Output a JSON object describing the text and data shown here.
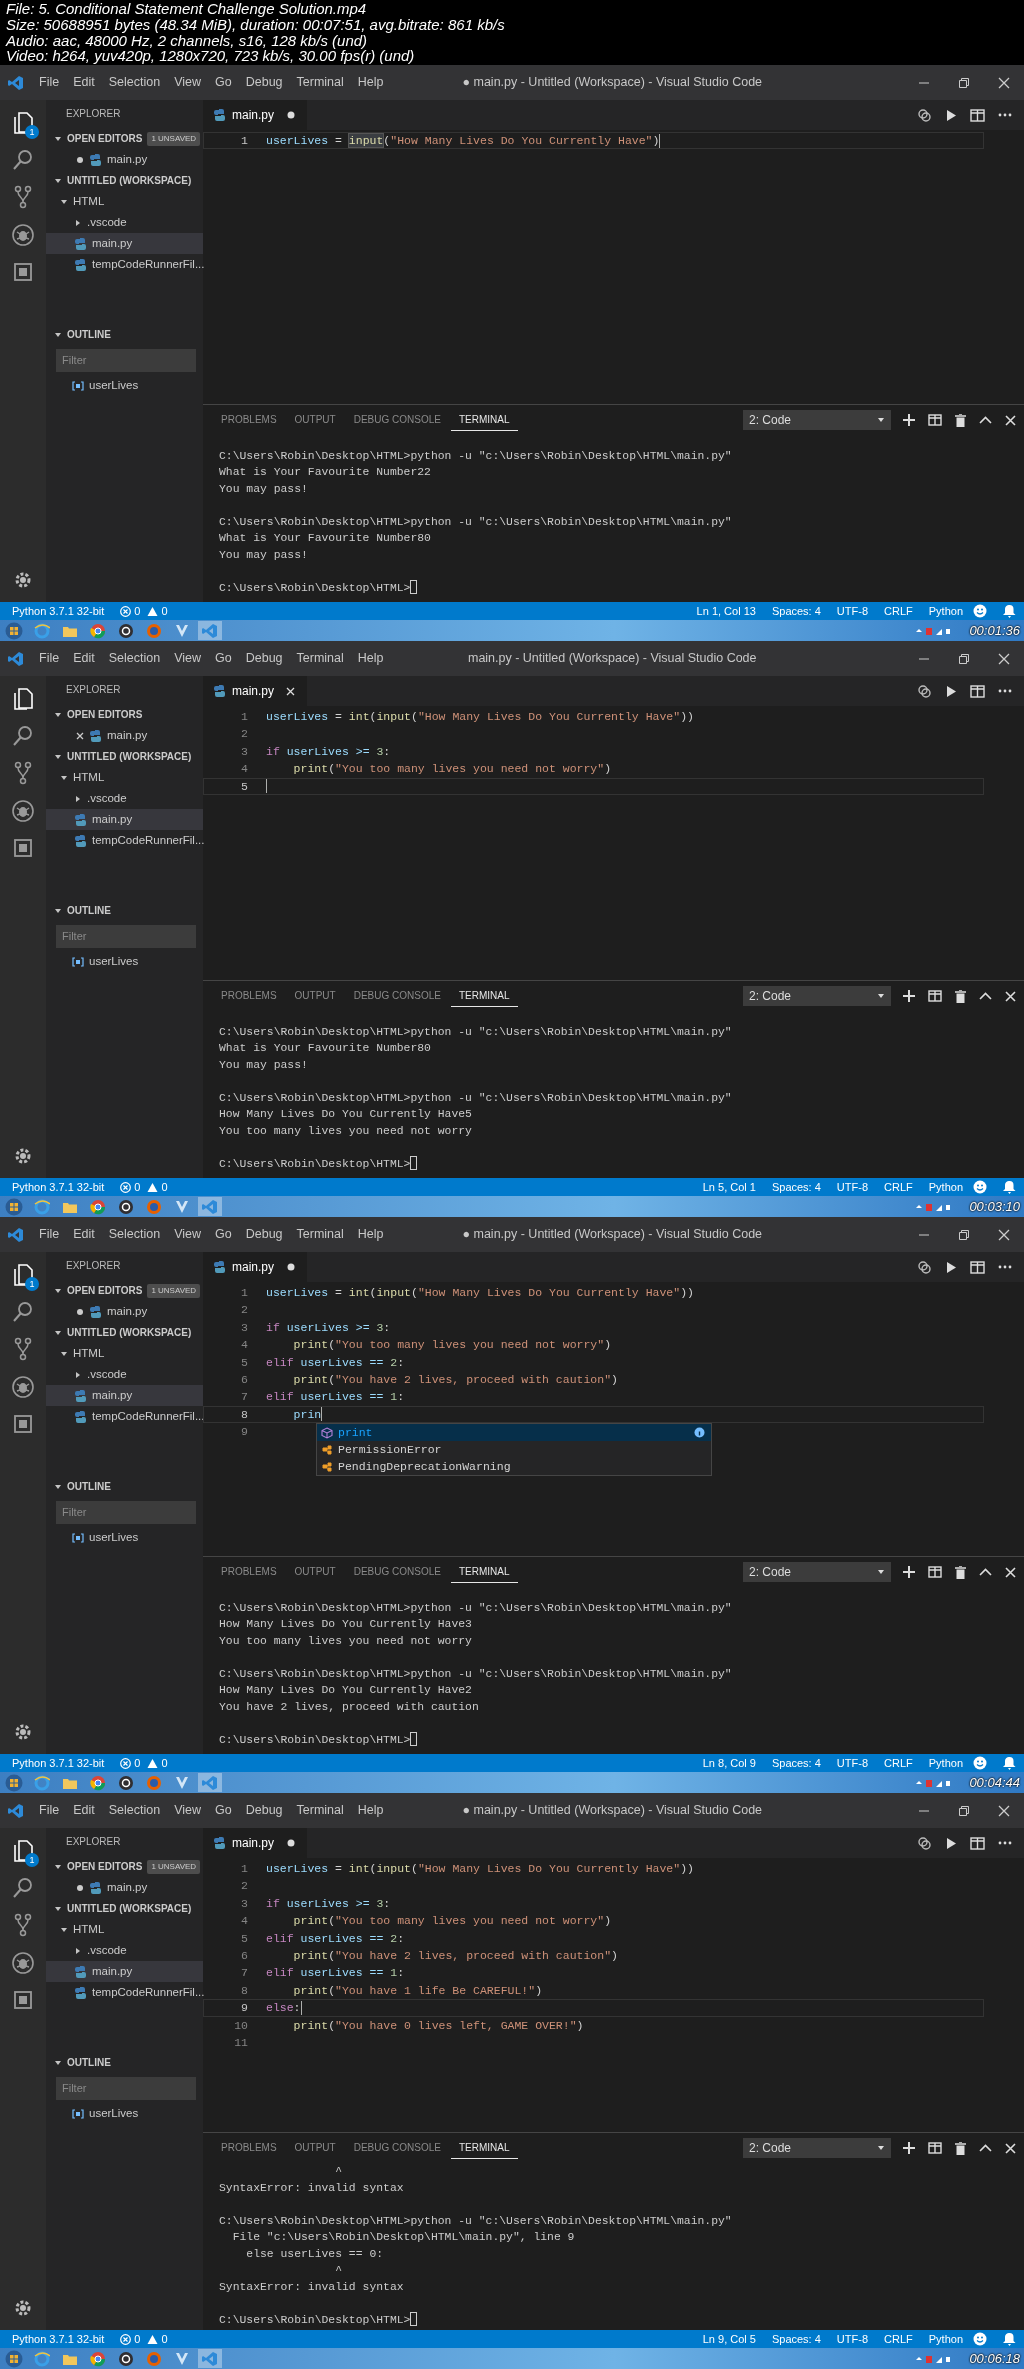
{
  "file_info": [
    "File: 5. Conditional Statement Challenge Solution.mp4",
    "Size: 50688951 bytes (48.34 MiB), duration: 00:07:51, avg.bitrate: 861 kb/s",
    "Audio: aac, 48000 Hz, 2 channels, s16, 128 kb/s (und)",
    "Video: h264, yuv420p, 1280x720, 723 kb/s, 30.00 fps(r) (und)"
  ],
  "frames": [
    {
      "window": {
        "title": "● main.py - Untitled (Workspace) - Visual Studio Code"
      },
      "menu": [
        "File",
        "Edit",
        "Selection",
        "View",
        "Go",
        "Debug",
        "Terminal",
        "Help"
      ],
      "activity_badge": "1",
      "sidebar": {
        "title": "EXPLORER",
        "open_editors": {
          "label": "OPEN EDITORS",
          "expanded": true,
          "badge": "1 UNSAVED",
          "items": [
            {
              "label": "main.py",
              "dirty": true
            }
          ]
        },
        "workspace": {
          "label": "UNTITLED (WORKSPACE)",
          "expanded": true,
          "tree": [
            {
              "label": "HTML",
              "kind": "folder",
              "expanded": true,
              "selected": false,
              "children": [
                {
                  "label": ".vscode",
                  "kind": "folder",
                  "expanded": false,
                  "selected": false
                },
                {
                  "label": "main.py",
                  "kind": "file",
                  "selected": true
                },
                {
                  "label": "tempCodeRunnerFil...",
                  "kind": "file",
                  "selected": false
                }
              ]
            }
          ]
        },
        "outline": {
          "label": "OUTLINE",
          "expanded": true,
          "filter": {
            "placeholder": "Filter"
          },
          "items": [
            "userLives"
          ]
        }
      },
      "editor": {
        "tab": {
          "label": "main.py",
          "dirty": true
        },
        "lines": [
          {
            "number": "1",
            "current": true,
            "tokens": [
              {
                "text": "userLives",
                "kind": "var"
              },
              {
                "text": " = ",
                "kind": "op"
              },
              {
                "text": "input",
                "kind": "match"
              },
              {
                "text": "(",
                "kind": "op"
              },
              {
                "text": "\"How Many Lives Do You Currently Have\"",
                "kind": "str"
              },
              {
                "text": ")",
                "kind": "op"
              }
            ]
          }
        ]
      },
      "panel": {
        "tabs": [
          {
            "label": "PROBLEMS",
            "selected": false
          },
          {
            "label": "OUTPUT",
            "selected": false
          },
          {
            "label": "DEBUG CONSOLE",
            "selected": false
          },
          {
            "label": "TERMINAL",
            "selected": true
          }
        ],
        "terminal_select": "2: Code",
        "terminal": [
          [
            "C:\\Users\\Robin\\Desktop\\HTML>python -u \"c:\\Users\\Robin\\Desktop\\HTML\\main.py\"",
            "What is Your Favourite Number22",
            "You may pass!"
          ],
          [
            "C:\\Users\\Robin\\Desktop\\HTML>python -u \"c:\\Users\\Robin\\Desktop\\HTML\\main.py\"",
            "What is Your Favourite Number80",
            "You may pass!"
          ],
          [
            "C:\\Users\\Robin\\Desktop\\HTML>"
          ]
        ]
      },
      "status_bar": {
        "interpreter": "Python 3.7.1 32-bit",
        "errors": "0",
        "warnings": "0",
        "items": [
          "Ln 1, Col 13",
          "Spaces: 4",
          "UTF-8",
          "CRLF",
          "Python"
        ]
      },
      "timestamp": "00:01:36"
    },
    {
      "window": {
        "title": "main.py - Untitled (Workspace) - Visual Studio Code"
      },
      "menu": [
        "File",
        "Edit",
        "Selection",
        "View",
        "Go",
        "Debug",
        "Terminal",
        "Help"
      ],
      "sidebar": {
        "title": "EXPLORER",
        "open_editors": {
          "label": "OPEN EDITORS",
          "expanded": true,
          "items": [
            {
              "label": "main.py",
              "dirty": false
            }
          ]
        },
        "workspace": {
          "label": "UNTITLED (WORKSPACE)",
          "expanded": true,
          "tree": [
            {
              "label": "HTML",
              "kind": "folder",
              "expanded": true,
              "selected": false,
              "children": [
                {
                  "label": ".vscode",
                  "kind": "folder",
                  "expanded": false,
                  "selected": false
                },
                {
                  "label": "main.py",
                  "kind": "file",
                  "selected": true
                },
                {
                  "label": "tempCodeRunnerFil...",
                  "kind": "file",
                  "selected": false
                }
              ]
            }
          ]
        },
        "outline": {
          "label": "OUTLINE",
          "expanded": true,
          "filter": {
            "placeholder": "Filter"
          },
          "items": [
            "userLives"
          ]
        }
      },
      "editor": {
        "tab": {
          "label": "main.py",
          "dirty": false
        },
        "lines": [
          {
            "number": "1",
            "current": false,
            "tokens": [
              {
                "text": "userLives",
                "kind": "var"
              },
              {
                "text": " = ",
                "kind": "op"
              },
              {
                "text": "int",
                "kind": "func"
              },
              {
                "text": "(",
                "kind": "op"
              },
              {
                "text": "input",
                "kind": "func"
              },
              {
                "text": "(",
                "kind": "op"
              },
              {
                "text": "\"How Many Lives Do You Currently Have\"",
                "kind": "str"
              },
              {
                "text": "))",
                "kind": "op"
              }
            ]
          },
          {
            "number": "2",
            "current": false
          },
          {
            "number": "3",
            "current": false,
            "tokens": [
              {
                "text": "if",
                "kind": "kw"
              },
              {
                "text": " userLives >= ",
                "kind": "var"
              },
              {
                "text": "3",
                "kind": "num"
              },
              {
                "text": ":",
                "kind": "op"
              }
            ]
          },
          {
            "number": "4",
            "current": false,
            "tokens": [
              {
                "text": "    print",
                "kind": "func"
              },
              {
                "text": "(",
                "kind": "op"
              },
              {
                "text": "\"You too many lives you need not worry\"",
                "kind": "str"
              },
              {
                "text": ")",
                "kind": "op"
              }
            ]
          },
          {
            "number": "5",
            "current": true
          }
        ]
      },
      "panel": {
        "tabs": [
          {
            "label": "PROBLEMS",
            "selected": false
          },
          {
            "label": "OUTPUT",
            "selected": false
          },
          {
            "label": "DEBUG CONSOLE",
            "selected": false
          },
          {
            "label": "TERMINAL",
            "selected": true
          }
        ],
        "terminal_select": "2: Code",
        "terminal": [
          [
            "C:\\Users\\Robin\\Desktop\\HTML>python -u \"c:\\Users\\Robin\\Desktop\\HTML\\main.py\"",
            "What is Your Favourite Number80",
            "You may pass!"
          ],
          [
            "C:\\Users\\Robin\\Desktop\\HTML>python -u \"c:\\Users\\Robin\\Desktop\\HTML\\main.py\"",
            "How Many Lives Do You Currently Have5",
            "You too many lives you need not worry"
          ],
          [
            "C:\\Users\\Robin\\Desktop\\HTML>"
          ]
        ]
      },
      "status_bar": {
        "interpreter": "Python 3.7.1 32-bit",
        "errors": "0",
        "warnings": "0",
        "items": [
          "Ln 5, Col 1",
          "Spaces: 4",
          "UTF-8",
          "CRLF",
          "Python"
        ]
      },
      "timestamp": "00:03:10"
    },
    {
      "window": {
        "title": "● main.py - Untitled (Workspace) - Visual Studio Code"
      },
      "menu": [
        "File",
        "Edit",
        "Selection",
        "View",
        "Go",
        "Debug",
        "Terminal",
        "Help"
      ],
      "activity_badge": "1",
      "sidebar": {
        "title": "EXPLORER",
        "open_editors": {
          "label": "OPEN EDITORS",
          "expanded": true,
          "badge": "1 UNSAVED",
          "items": [
            {
              "label": "main.py",
              "dirty": true
            }
          ]
        },
        "workspace": {
          "label": "UNTITLED (WORKSPACE)",
          "expanded": true,
          "tree": [
            {
              "label": "HTML",
              "kind": "folder",
              "expanded": true,
              "selected": false,
              "children": [
                {
                  "label": ".vscode",
                  "kind": "folder",
                  "expanded": false,
                  "selected": false
                },
                {
                  "label": "main.py",
                  "kind": "file",
                  "selected": true
                },
                {
                  "label": "tempCodeRunnerFil...",
                  "kind": "file",
                  "selected": false
                }
              ]
            }
          ]
        },
        "outline": {
          "label": "OUTLINE",
          "expanded": true,
          "filter": {
            "placeholder": "Filter"
          },
          "items": [
            "userLives"
          ]
        }
      },
      "editor": {
        "tab": {
          "label": "main.py",
          "dirty": true
        },
        "lines": [
          {
            "number": "1",
            "current": false,
            "tokens": [
              {
                "text": "userLives",
                "kind": "var"
              },
              {
                "text": " = ",
                "kind": "op"
              },
              {
                "text": "int",
                "kind": "func"
              },
              {
                "text": "(",
                "kind": "op"
              },
              {
                "text": "input",
                "kind": "func"
              },
              {
                "text": "(",
                "kind": "op"
              },
              {
                "text": "\"How Many Lives Do You Currently Have\"",
                "kind": "str"
              },
              {
                "text": "))",
                "kind": "op"
              }
            ]
          },
          {
            "number": "2",
            "current": false
          },
          {
            "number": "3",
            "current": false,
            "tokens": [
              {
                "text": "if",
                "kind": "kw"
              },
              {
                "text": " userLives >= ",
                "kind": "var"
              },
              {
                "text": "3",
                "kind": "num"
              },
              {
                "text": ":",
                "kind": "op"
              }
            ]
          },
          {
            "number": "4",
            "current": false,
            "tokens": [
              {
                "text": "    print",
                "kind": "func"
              },
              {
                "text": "(",
                "kind": "op"
              },
              {
                "text": "\"You too many lives you need not worry\"",
                "kind": "str"
              },
              {
                "text": ")",
                "kind": "op"
              }
            ]
          },
          {
            "number": "5",
            "current": false,
            "tokens": [
              {
                "text": "elif",
                "kind": "kw"
              },
              {
                "text": " userLives == ",
                "kind": "var"
              },
              {
                "text": "2",
                "kind": "num"
              },
              {
                "text": ":",
                "kind": "op"
              }
            ]
          },
          {
            "number": "6",
            "current": false,
            "tokens": [
              {
                "text": "    print",
                "kind": "func"
              },
              {
                "text": "(",
                "kind": "op"
              },
              {
                "text": "\"You have 2 lives, proceed with caution\"",
                "kind": "str"
              },
              {
                "text": ")",
                "kind": "op"
              }
            ]
          },
          {
            "number": "7",
            "current": false,
            "tokens": [
              {
                "text": "elif",
                "kind": "kw"
              },
              {
                "text": " userLives == ",
                "kind": "var"
              },
              {
                "text": "1",
                "kind": "num"
              },
              {
                "text": ":",
                "kind": "op"
              }
            ]
          },
          {
            "number": "8",
            "current": true,
            "tokens": [
              {
                "text": "    prin",
                "kind": "var"
              }
            ]
          },
          {
            "number": "9",
            "current": false
          }
        ],
        "autocomplete": [
          {
            "label": "print",
            "kind": "function",
            "selected": true
          },
          {
            "label": "PermissionError",
            "kind": "class",
            "selected": false
          },
          {
            "label": "PendingDeprecationWarning",
            "kind": "class",
            "selected": false
          }
        ]
      },
      "panel": {
        "tabs": [
          {
            "label": "PROBLEMS",
            "selected": false
          },
          {
            "label": "OUTPUT",
            "selected": false
          },
          {
            "label": "DEBUG CONSOLE",
            "selected": false
          },
          {
            "label": "TERMINAL",
            "selected": true
          }
        ],
        "terminal_select": "2: Code",
        "terminal": [
          [
            "C:\\Users\\Robin\\Desktop\\HTML>python -u \"c:\\Users\\Robin\\Desktop\\HTML\\main.py\"",
            "How Many Lives Do You Currently Have3",
            "You too many lives you need not worry"
          ],
          [
            "C:\\Users\\Robin\\Desktop\\HTML>python -u \"c:\\Users\\Robin\\Desktop\\HTML\\main.py\"",
            "How Many Lives Do You Currently Have2",
            "You have 2 lives, proceed with caution"
          ],
          [
            "C:\\Users\\Robin\\Desktop\\HTML>"
          ]
        ]
      },
      "status_bar": {
        "interpreter": "Python 3.7.1 32-bit",
        "errors": "0",
        "warnings": "0",
        "items": [
          "Ln 8, Col 9",
          "Spaces: 4",
          "UTF-8",
          "CRLF",
          "Python"
        ]
      },
      "timestamp": "00:04:44"
    },
    {
      "window": {
        "title": "● main.py - Untitled (Workspace) - Visual Studio Code"
      },
      "menu": [
        "File",
        "Edit",
        "Selection",
        "View",
        "Go",
        "Debug",
        "Terminal",
        "Help"
      ],
      "activity_badge": "1",
      "sidebar": {
        "title": "EXPLORER",
        "open_editors": {
          "label": "OPEN EDITORS",
          "expanded": true,
          "badge": "1 UNSAVED",
          "items": [
            {
              "label": "main.py",
              "dirty": true
            }
          ]
        },
        "workspace": {
          "label": "UNTITLED (WORKSPACE)",
          "expanded": true,
          "tree": [
            {
              "label": "HTML",
              "kind": "folder",
              "expanded": true,
              "selected": false,
              "children": [
                {
                  "label": ".vscode",
                  "kind": "folder",
                  "expanded": false,
                  "selected": false
                },
                {
                  "label": "main.py",
                  "kind": "file",
                  "selected": true
                },
                {
                  "label": "tempCodeRunnerFil...",
                  "kind": "file",
                  "selected": false
                }
              ]
            }
          ]
        },
        "outline": {
          "label": "OUTLINE",
          "expanded": true,
          "filter": {
            "placeholder": "Filter"
          },
          "items": [
            "userLives"
          ]
        }
      },
      "editor": {
        "tab": {
          "label": "main.py",
          "dirty": true
        },
        "lines": [
          {
            "number": "1",
            "current": false,
            "tokens": [
              {
                "text": "userLives",
                "kind": "var"
              },
              {
                "text": " = ",
                "kind": "op"
              },
              {
                "text": "int",
                "kind": "func"
              },
              {
                "text": "(",
                "kind": "op"
              },
              {
                "text": "input",
                "kind": "func"
              },
              {
                "text": "(",
                "kind": "op"
              },
              {
                "text": "\"How Many Lives Do You Currently Have\"",
                "kind": "str"
              },
              {
                "text": "))",
                "kind": "op"
              }
            ]
          },
          {
            "number": "2",
            "current": false
          },
          {
            "number": "3",
            "current": false,
            "tokens": [
              {
                "text": "if",
                "kind": "kw"
              },
              {
                "text": " userLives >= ",
                "kind": "var"
              },
              {
                "text": "3",
                "kind": "num"
              },
              {
                "text": ":",
                "kind": "op"
              }
            ]
          },
          {
            "number": "4",
            "current": false,
            "tokens": [
              {
                "text": "    print",
                "kind": "func"
              },
              {
                "text": "(",
                "kind": "op"
              },
              {
                "text": "\"You too many lives you need not worry\"",
                "kind": "str"
              },
              {
                "text": ")",
                "kind": "op"
              }
            ]
          },
          {
            "number": "5",
            "current": false,
            "tokens": [
              {
                "text": "elif",
                "kind": "kw"
              },
              {
                "text": " userLives == ",
                "kind": "var"
              },
              {
                "text": "2",
                "kind": "num"
              },
              {
                "text": ":",
                "kind": "op"
              }
            ]
          },
          {
            "number": "6",
            "current": false,
            "tokens": [
              {
                "text": "    print",
                "kind": "func"
              },
              {
                "text": "(",
                "kind": "op"
              },
              {
                "text": "\"You have 2 lives, proceed with caution\"",
                "kind": "str"
              },
              {
                "text": ")",
                "kind": "op"
              }
            ]
          },
          {
            "number": "7",
            "current": false,
            "tokens": [
              {
                "text": "elif",
                "kind": "kw"
              },
              {
                "text": " userLives == ",
                "kind": "var"
              },
              {
                "text": "1",
                "kind": "num"
              },
              {
                "text": ":",
                "kind": "op"
              }
            ]
          },
          {
            "number": "8",
            "current": false,
            "tokens": [
              {
                "text": "    print",
                "kind": "func"
              },
              {
                "text": "(",
                "kind": "op"
              },
              {
                "text": "\"You have 1 life Be CAREFUL!\"",
                "kind": "str"
              },
              {
                "text": ")",
                "kind": "op"
              }
            ]
          },
          {
            "number": "9",
            "current": true,
            "tokens": [
              {
                "text": "else",
                "kind": "kw"
              },
              {
                "text": ":",
                "kind": "op"
              }
            ]
          },
          {
            "number": "10",
            "current": false,
            "tokens": [
              {
                "text": "    print",
                "kind": "func"
              },
              {
                "text": "(",
                "kind": "op"
              },
              {
                "text": "\"You have 0 lives left, GAME OVER!\"",
                "kind": "str"
              },
              {
                "text": ")",
                "kind": "op"
              }
            ]
          },
          {
            "number": "11",
            "current": false
          }
        ]
      },
      "panel": {
        "tabs": [
          {
            "label": "PROBLEMS",
            "selected": false
          },
          {
            "label": "OUTPUT",
            "selected": false
          },
          {
            "label": "DEBUG CONSOLE",
            "selected": false
          },
          {
            "label": "TERMINAL",
            "selected": true
          }
        ],
        "terminal_select": "2: Code",
        "terminal": [
          [
            "                 ^",
            "SyntaxError: invalid syntax"
          ],
          [
            "C:\\Users\\Robin\\Desktop\\HTML>python -u \"c:\\Users\\Robin\\Desktop\\HTML\\main.py\"",
            "  File \"c:\\Users\\Robin\\Desktop\\HTML\\main.py\", line 9",
            "    else userLives == 0:",
            "                 ^",
            "SyntaxError: invalid syntax"
          ],
          [
            "C:\\Users\\Robin\\Desktop\\HTML>"
          ]
        ]
      },
      "status_bar": {
        "interpreter": "Python 3.7.1 32-bit",
        "errors": "0",
        "warnings": "0",
        "items": [
          "Ln 9, Col 5",
          "Spaces: 4",
          "UTF-8",
          "CRLF",
          "Python"
        ]
      },
      "timestamp": "00:06:18"
    }
  ]
}
